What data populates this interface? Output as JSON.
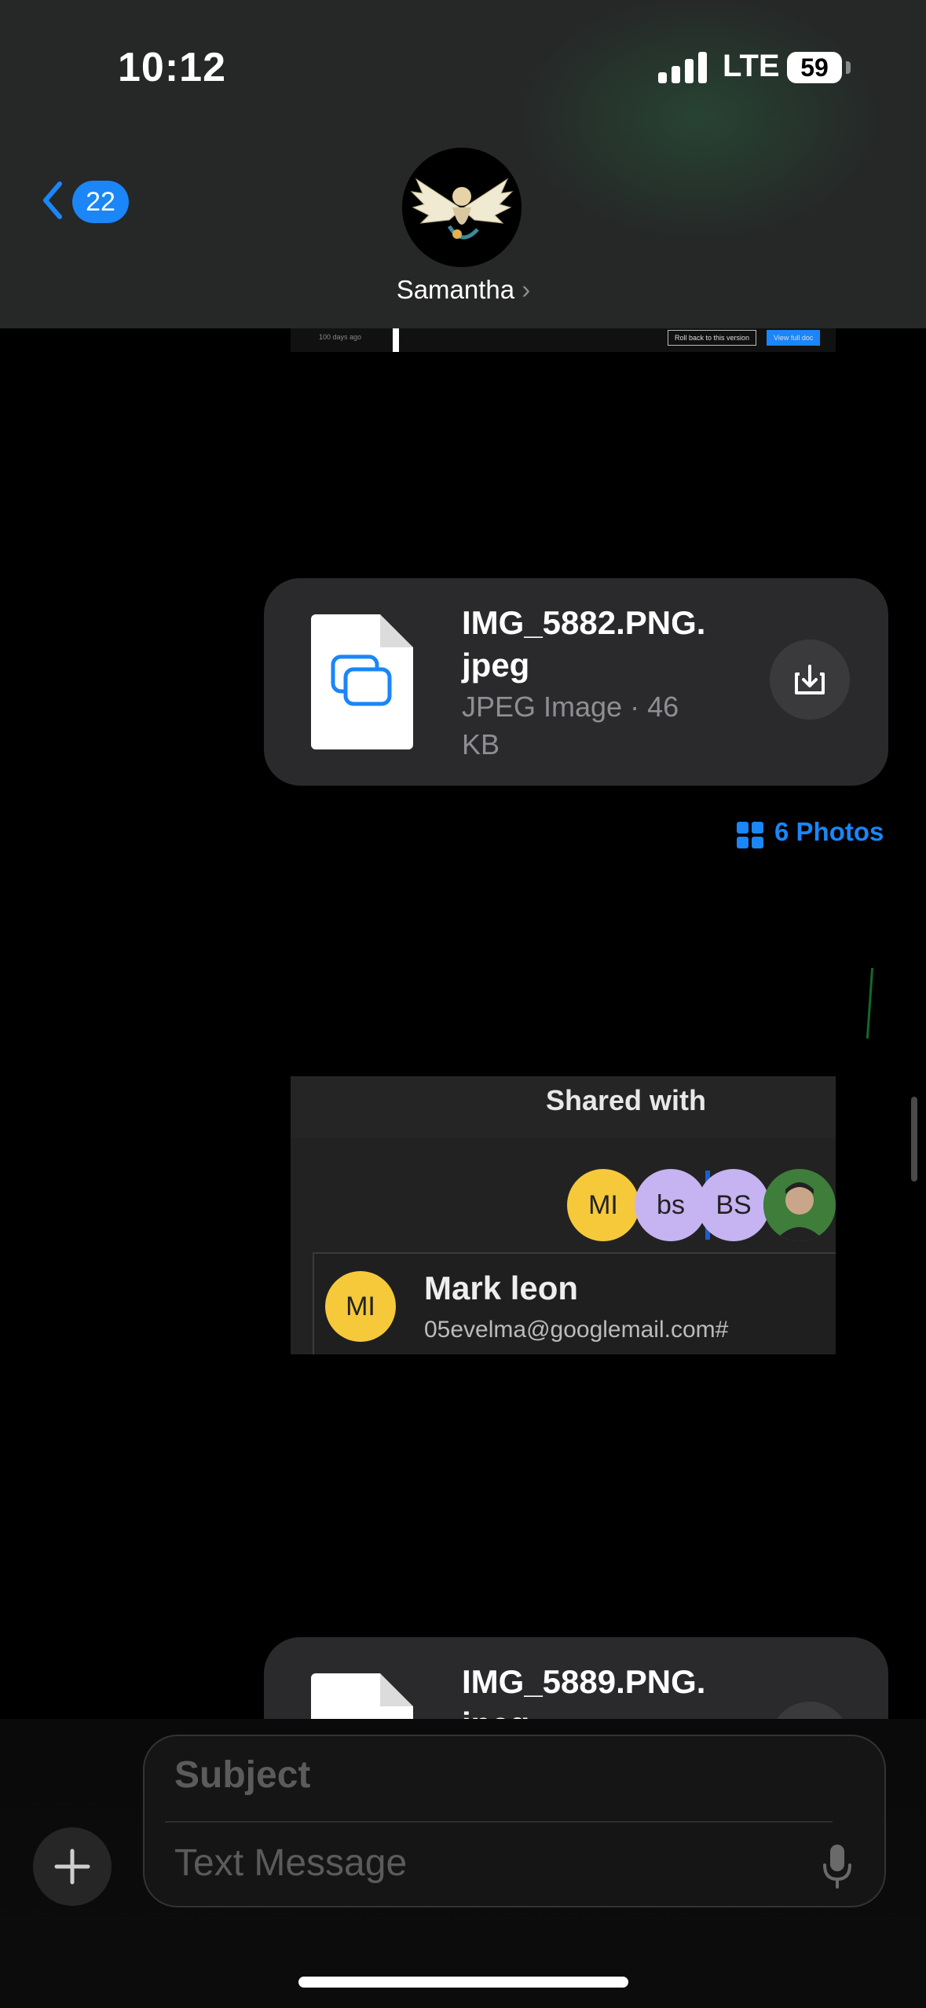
{
  "status_bar": {
    "time": "10:12",
    "network": "LTE",
    "battery": "59"
  },
  "nav": {
    "back_count": "22",
    "contact_name": "Samantha"
  },
  "messages": {
    "file1": {
      "name": "IMG_5882.PNG.\njpeg",
      "name_line1": "IMG_5882.PNG.",
      "name_line2": "jpeg",
      "meta_line1": "JPEG Image · 46",
      "meta_line2": "KB"
    },
    "photos_link": "6 Photos",
    "shared_image": {
      "title": "Shared with",
      "chips": [
        "MI",
        "bs",
        "BS"
      ],
      "person_initials": "MI",
      "person_name": "Mark leon",
      "person_email": "05evelma@googlemail.com#"
    },
    "file2": {
      "name_line1": "IMG_5889.PNG.",
      "name_line2": "jpeg"
    },
    "top_image_buttons": [
      "Roll back to this version",
      "View full doc"
    ],
    "top_image_caption": "100 days ago"
  },
  "composer": {
    "subject_placeholder": "Subject",
    "text_placeholder": "Text Message"
  },
  "colors": {
    "accent": "#1a86f7",
    "bubble": "#2a2a2c",
    "chip_yellow": "#f5c93a",
    "chip_lavender": "#c6b3f2"
  },
  "icons": [
    "back-chevron-icon",
    "document-icon",
    "download-icon",
    "photos-grid-icon",
    "plus-icon",
    "microphone-icon"
  ]
}
